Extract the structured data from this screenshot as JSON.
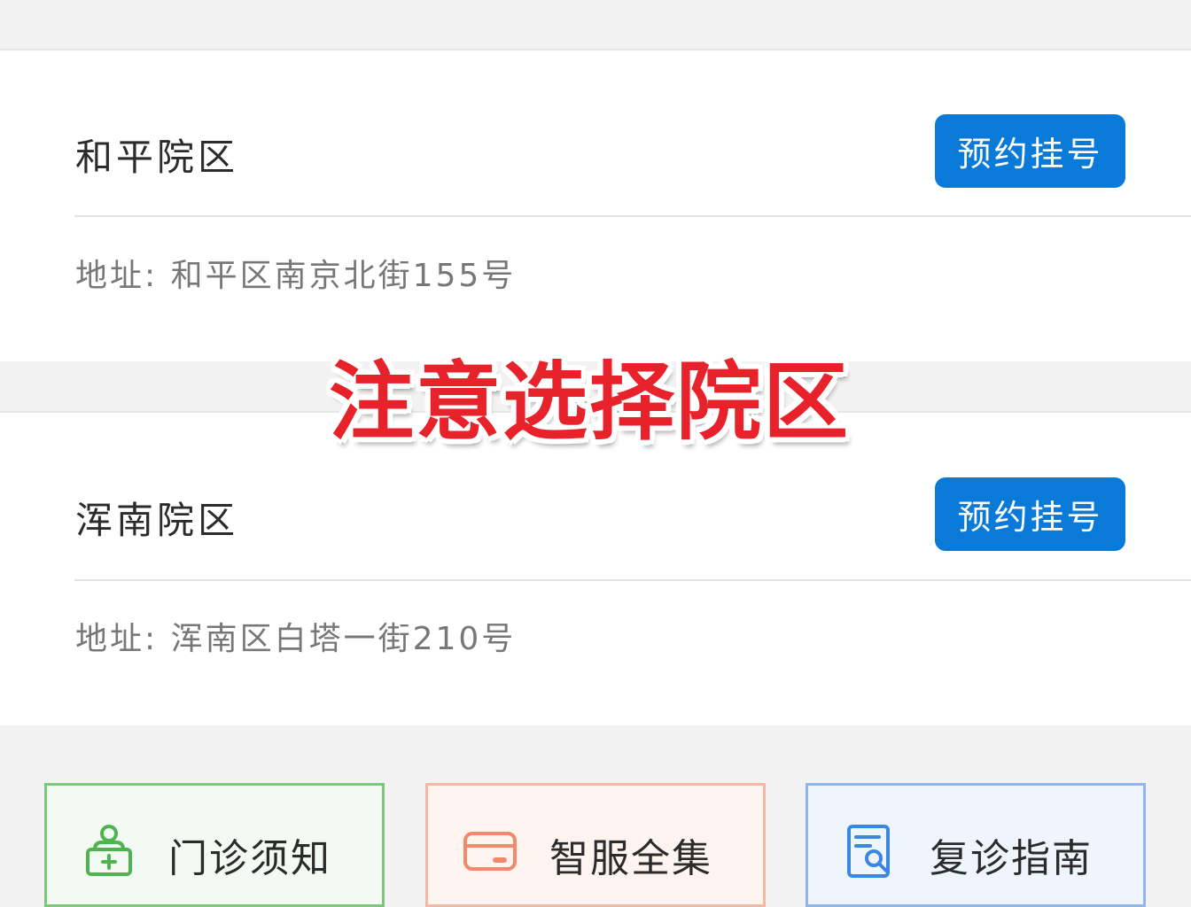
{
  "campuses": [
    {
      "name": "和平院区",
      "button_label": "预约挂号",
      "address": "地址: 和平区南京北街155号"
    },
    {
      "name": "浑南院区",
      "button_label": "预约挂号",
      "address": "地址: 浑南区白塔一街210号"
    }
  ],
  "overlay": {
    "text": "注意选择院区"
  },
  "services": [
    {
      "label": "门诊须知",
      "icon": "clinic-user-icon",
      "accent": "#4fb34f"
    },
    {
      "label": "智服全集",
      "icon": "card-icon",
      "accent": "#f08a6a"
    },
    {
      "label": "复诊指南",
      "icon": "document-search-icon",
      "accent": "#3b86e0"
    }
  ],
  "colors": {
    "button": "#0a7ad9",
    "overlay_text": "#e8222a",
    "background": "#f2f2f2"
  }
}
